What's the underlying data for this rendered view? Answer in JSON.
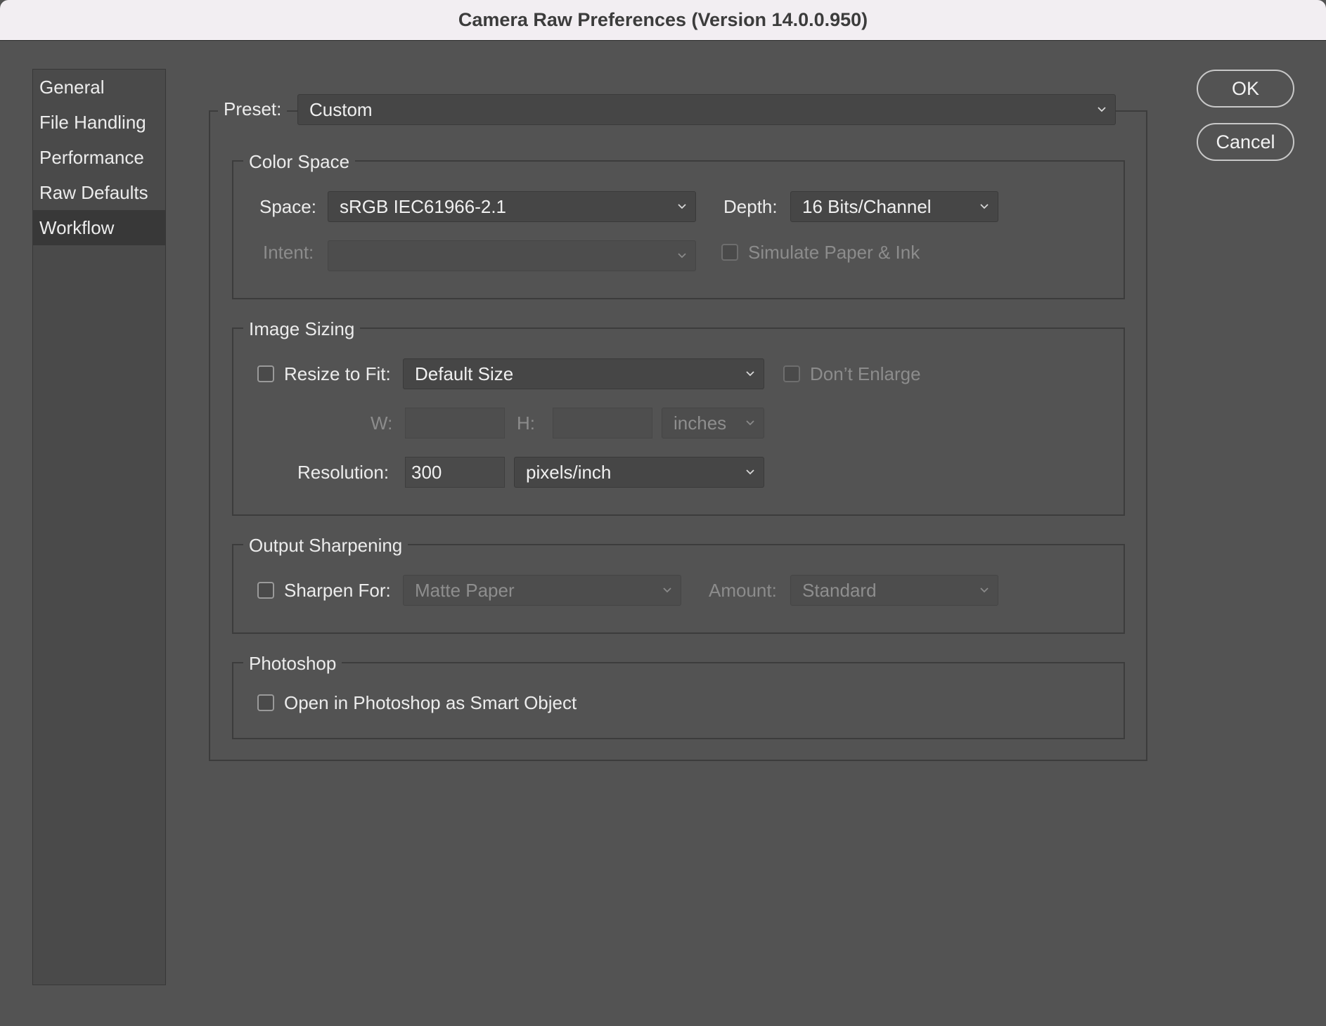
{
  "window": {
    "title": "Camera Raw Preferences  (Version 14.0.0.950)"
  },
  "sidebar": {
    "items": [
      {
        "label": "General",
        "active": false
      },
      {
        "label": "File Handling",
        "active": false
      },
      {
        "label": "Performance",
        "active": false
      },
      {
        "label": "Raw Defaults",
        "active": false
      },
      {
        "label": "Workflow",
        "active": true
      }
    ]
  },
  "buttons": {
    "ok": "OK",
    "cancel": "Cancel"
  },
  "preset": {
    "label": "Preset:",
    "value": "Custom"
  },
  "color_space": {
    "title": "Color Space",
    "space_label": "Space:",
    "space_value": "sRGB IEC61966-2.1",
    "depth_label": "Depth:",
    "depth_value": "16 Bits/Channel",
    "intent_label": "Intent:",
    "intent_value": "",
    "simulate_label": "Simulate Paper & Ink",
    "simulate_checked": false
  },
  "image_sizing": {
    "title": "Image Sizing",
    "resize_label": "Resize to Fit:",
    "resize_checked": false,
    "resize_value": "Default Size",
    "dont_enlarge_label": "Don’t Enlarge",
    "dont_enlarge_checked": false,
    "w_label": "W:",
    "w_value": "",
    "h_label": "H:",
    "h_value": "",
    "units_value": "inches",
    "resolution_label": "Resolution:",
    "resolution_value": "300",
    "resolution_units": "pixels/inch"
  },
  "output_sharpening": {
    "title": "Output Sharpening",
    "sharpen_label": "Sharpen For:",
    "sharpen_checked": false,
    "sharpen_value": "Matte Paper",
    "amount_label": "Amount:",
    "amount_value": "Standard"
  },
  "photoshop": {
    "title": "Photoshop",
    "smart_object_label": "Open in Photoshop as Smart Object",
    "smart_object_checked": false
  },
  "colors": {
    "background": "#535353",
    "titlebar": "#f2eef2",
    "sidebar_active": "#383838",
    "control": "#464646"
  }
}
